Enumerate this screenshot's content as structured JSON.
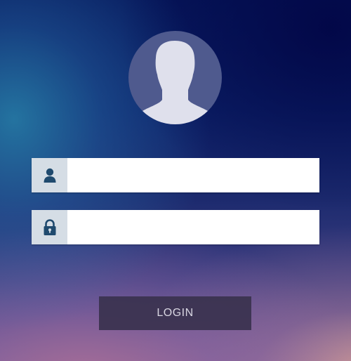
{
  "login_form": {
    "avatar_icon": "user-silhouette-icon",
    "username": {
      "icon": "user-icon",
      "value": "",
      "placeholder": ""
    },
    "password": {
      "icon": "lock-icon",
      "value": "",
      "placeholder": ""
    },
    "login_label": "LOGIN"
  },
  "colors": {
    "icon_color": "#1f4a6e",
    "icon_box_bg": "#d5dde5",
    "avatar_bg": "#4f5a8e",
    "avatar_silhouette": "#dfe0ec",
    "button_bg": "#3a324e",
    "button_text": "#d8d6e2"
  }
}
